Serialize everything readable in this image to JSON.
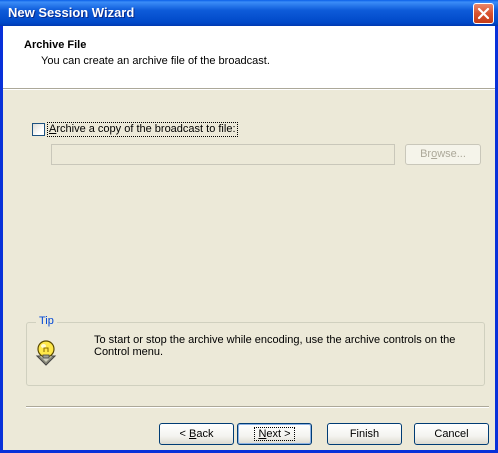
{
  "window": {
    "title": "New Session Wizard"
  },
  "header": {
    "title": "Archive File",
    "subtitle": "You can create an archive file of the broadcast."
  },
  "archive": {
    "checkbox_label_accel": "A",
    "checkbox_label_rest": "rchive a copy of the broadcast to file:",
    "checked": false,
    "path_value": "",
    "browse_pre": "Br",
    "browse_accel": "o",
    "browse_post": "wse..."
  },
  "tip": {
    "title": "Tip",
    "text": "To start or stop the archive while encoding, use the archive controls on the Control menu."
  },
  "buttons": {
    "back_pre": "< ",
    "back_accel": "B",
    "back_post": "ack",
    "next_accel": "N",
    "next_post": "ext >",
    "finish": "Finish",
    "cancel": "Cancel"
  },
  "icons": {
    "close": "close-icon",
    "tip": "lightbulb-icon"
  },
  "colors": {
    "titlebar": "#0054e3",
    "face": "#ece9d8",
    "tip_title": "#0046d5",
    "close": "#d8522e"
  }
}
